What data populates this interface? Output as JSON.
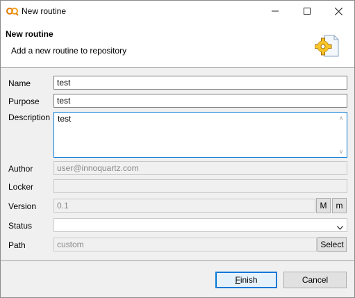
{
  "window": {
    "title": "New routine",
    "controls": {
      "minimize": "minimize-icon",
      "maximize": "maximize-icon",
      "close": "close-icon"
    }
  },
  "header": {
    "title": "New routine",
    "description": "Add a new routine to repository",
    "icon": "routine-gear-icon"
  },
  "form": {
    "name": {
      "label": "Name",
      "value": "test"
    },
    "purpose": {
      "label": "Purpose",
      "value": "test"
    },
    "description": {
      "label": "Description",
      "value": "test"
    },
    "author": {
      "label": "Author",
      "value": "user@innoquartz.com"
    },
    "locker": {
      "label": "Locker",
      "value": ""
    },
    "version": {
      "label": "Version",
      "value": "0.1",
      "major_label": "M",
      "minor_label": "m"
    },
    "status": {
      "label": "Status",
      "value": ""
    },
    "path": {
      "label": "Path",
      "value": "custom",
      "select_label": "Select"
    }
  },
  "buttons": {
    "finish_mnemonic": "F",
    "finish_rest": "inish",
    "cancel": "Cancel"
  },
  "colors": {
    "accent": "#0078d7",
    "header_bg": "#ffffff",
    "body_bg": "#f0f0f0"
  }
}
